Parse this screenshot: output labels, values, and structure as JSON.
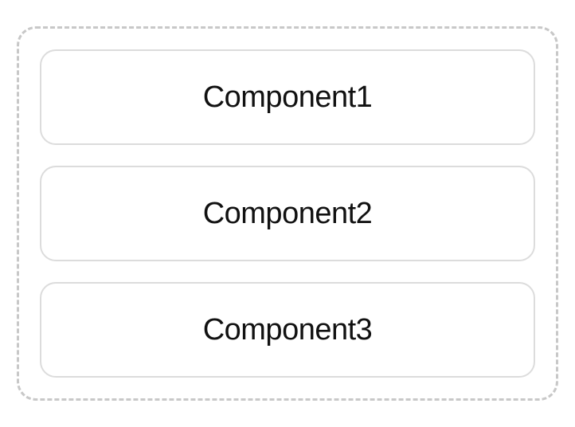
{
  "components": [
    {
      "label": "Component1"
    },
    {
      "label": "Component2"
    },
    {
      "label": "Component3"
    }
  ]
}
